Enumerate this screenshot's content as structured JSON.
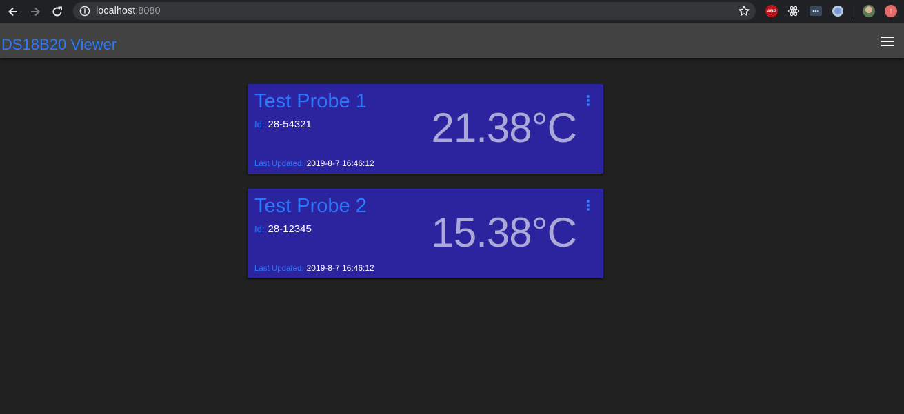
{
  "browser": {
    "url_host": "localhost",
    "url_port": ":8080",
    "extensions": {
      "adblock_label": "ABP",
      "dots_label": "•••",
      "update_label": "↑"
    }
  },
  "app": {
    "title": "DS18B20 Viewer"
  },
  "labels": {
    "id": "Id:",
    "last_updated": "Last Updated:"
  },
  "probes": [
    {
      "name": "Test Probe 1",
      "id": "28-54321",
      "temperature": "21.38°C",
      "last_updated": "2019-8-7 16:46:12"
    },
    {
      "name": "Test Probe 2",
      "id": "28-12345",
      "temperature": "15.38°C",
      "last_updated": "2019-8-7 16:46:12"
    }
  ],
  "colors": {
    "accent": "#2979ff",
    "card_background": "#2c239e",
    "temperature_text": "#a9a8d6",
    "app_background": "#212121",
    "toolbar": "#424242"
  }
}
